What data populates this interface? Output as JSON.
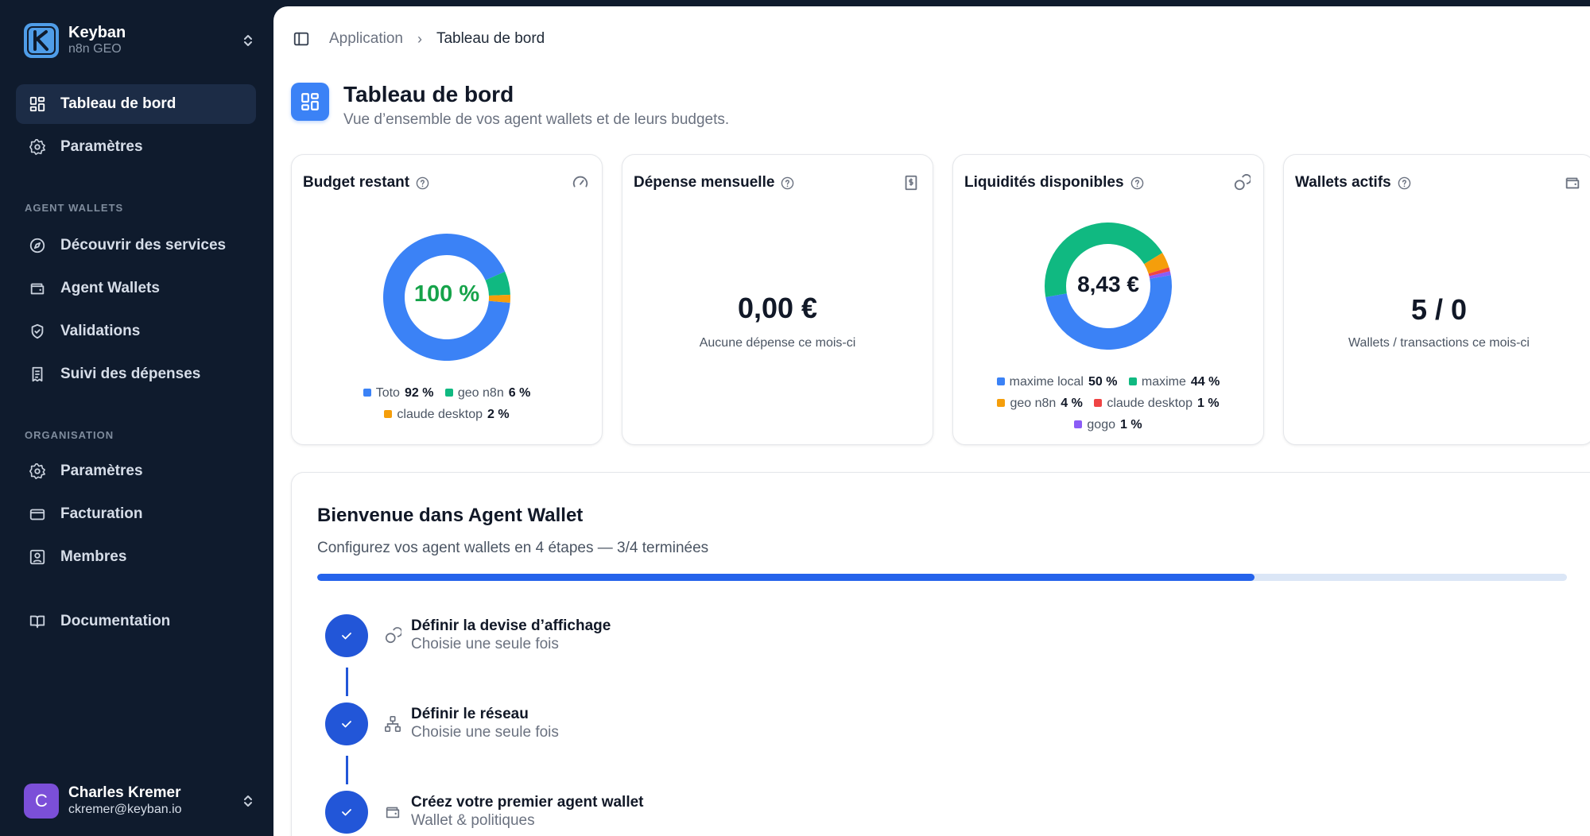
{
  "org": {
    "name": "Keyban",
    "subtitle": "n8n GEO",
    "logo_letter": "K"
  },
  "nav": {
    "top": [
      {
        "label": "Tableau de bord",
        "icon": "grid-icon",
        "active": true
      },
      {
        "label": "Paramètres",
        "icon": "gear-icon"
      }
    ],
    "agent_section_label": "AGENT WALLETS",
    "agent": [
      {
        "label": "Découvrir des services",
        "icon": "compass-icon"
      },
      {
        "label": "Agent Wallets",
        "icon": "wallet-icon"
      },
      {
        "label": "Validations",
        "icon": "shield-check-icon"
      },
      {
        "label": "Suivi des dépenses",
        "icon": "receipt-icon"
      }
    ],
    "org_section_label": "ORGANISATION",
    "org": [
      {
        "label": "Paramètres",
        "icon": "gear-icon"
      },
      {
        "label": "Facturation",
        "icon": "credit-card-icon"
      },
      {
        "label": "Membres",
        "icon": "user-square-icon"
      }
    ],
    "documentation": {
      "label": "Documentation",
      "icon": "book-icon"
    }
  },
  "user": {
    "name": "Charles Kremer",
    "email": "ckremer@keyban.io",
    "initial": "C"
  },
  "breadcrumb": {
    "root": "Application",
    "separator": "›",
    "current": "Tableau de bord"
  },
  "page": {
    "title": "Tableau de bord",
    "subtitle": "Vue d’ensemble de vos agent wallets et de leurs budgets."
  },
  "cards": {
    "budget": {
      "title": "Budget restant",
      "center_label": "100 %",
      "legend": [
        {
          "name": "Toto",
          "pct": "92 %",
          "value": 92,
          "color": "#3b82f6"
        },
        {
          "name": "geo n8n",
          "pct": "6 %",
          "value": 6,
          "color": "#10b981"
        },
        {
          "name": "claude desktop",
          "pct": "2 %",
          "value": 2,
          "color": "#f59e0b"
        }
      ]
    },
    "spend": {
      "title": "Dépense mensuelle",
      "value": "0,00 €",
      "caption": "Aucune dépense ce mois-ci"
    },
    "liquidity": {
      "title": "Liquidités disponibles",
      "center_label": "8,43 €",
      "legend": [
        {
          "name": "maxime local",
          "pct": "50 %",
          "value": 50,
          "color": "#3b82f6"
        },
        {
          "name": "maxime",
          "pct": "44 %",
          "value": 44,
          "color": "#10b981"
        },
        {
          "name": "geo n8n",
          "pct": "4 %",
          "value": 4,
          "color": "#f59e0b"
        },
        {
          "name": "claude desktop",
          "pct": "1 %",
          "value": 1,
          "color": "#ef4444"
        },
        {
          "name": "gogo",
          "pct": "1 %",
          "value": 1,
          "color": "#8b5cf6"
        }
      ]
    },
    "wallets": {
      "title": "Wallets actifs",
      "value": "5 / 0",
      "caption": "Wallets / transactions ce mois-ci"
    }
  },
  "welcome": {
    "title": "Bienvenue dans Agent Wallet",
    "subtitle": "Configurez vos agent wallets en 4 étapes — 3/4 terminées",
    "progress": 0.75,
    "steps": [
      {
        "title": "Définir la devise d’affichage",
        "subtitle": "Choisie une seule fois",
        "icon": "coins-icon",
        "done": true
      },
      {
        "title": "Définir le réseau",
        "subtitle": "Choisie une seule fois",
        "icon": "network-icon",
        "done": true
      },
      {
        "title": "Créez votre premier agent wallet",
        "subtitle": "Wallet & politiques",
        "icon": "wallet-icon",
        "done": true
      }
    ]
  },
  "colors": {
    "sidebar_bg": "#0f1b2d",
    "accent": "#2563eb",
    "active_nav_bg": "#1c2c46"
  }
}
